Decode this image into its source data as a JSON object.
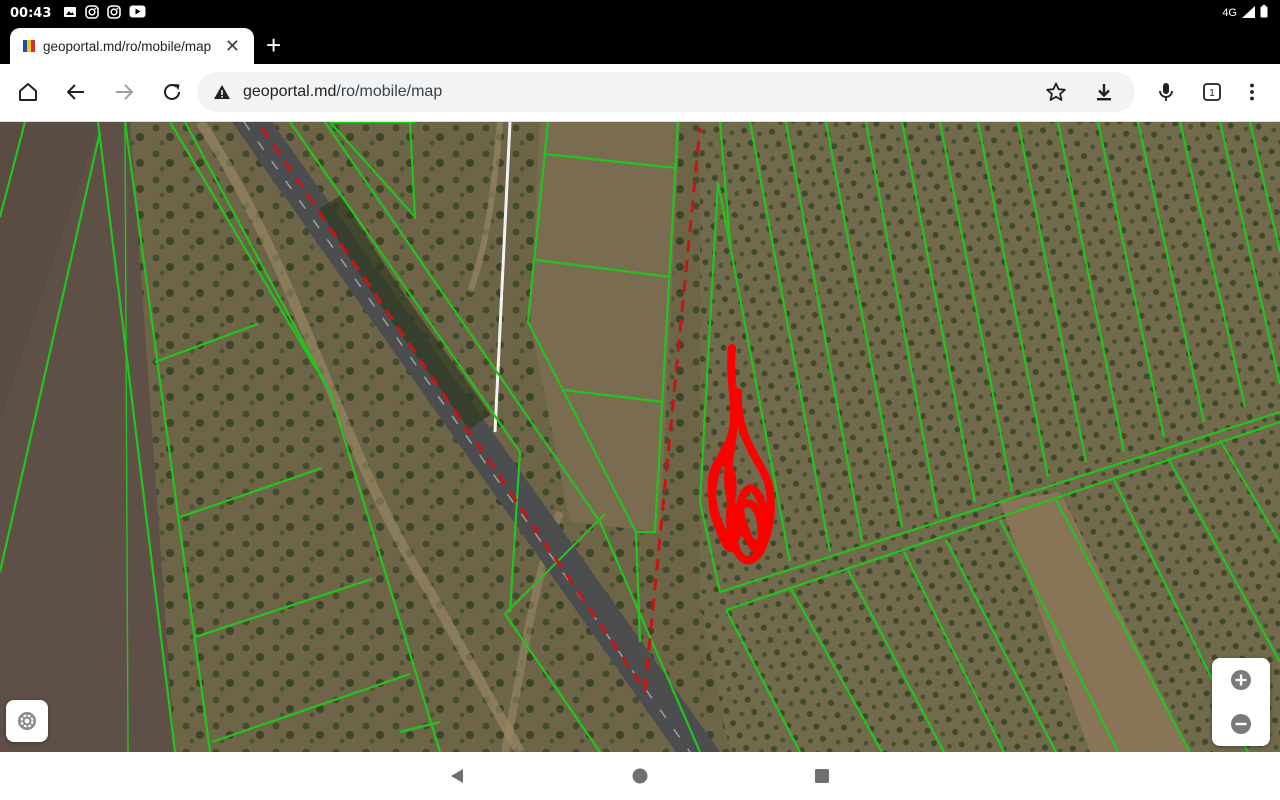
{
  "status_bar": {
    "time": "00:43",
    "notifications": [
      "image-icon",
      "instagram-icon",
      "instagram-icon",
      "youtube-icon"
    ],
    "network": "4G"
  },
  "browser": {
    "tab": {
      "title": "geoportal.md/ro/mobile/map"
    },
    "url": {
      "host": "geoportal.md",
      "path": "/ro/mobile/map"
    },
    "tab_count": "1",
    "toolbar_icons": [
      "home-icon",
      "back-icon",
      "forward-icon",
      "reload-icon",
      "star-icon",
      "download-icon",
      "mic-icon",
      "tab-switcher-icon",
      "more-icon"
    ]
  },
  "map": {
    "parcel_color": "#22c41e",
    "route_color": "#c81414",
    "drawing_color": "#ff0000",
    "zoom_in_icon": "plus-circle-icon",
    "zoom_out_icon": "minus-circle-icon",
    "settings_icon": "gear-icon"
  },
  "system_nav": [
    "back-triangle-icon",
    "home-circle-icon",
    "recents-square-icon"
  ]
}
